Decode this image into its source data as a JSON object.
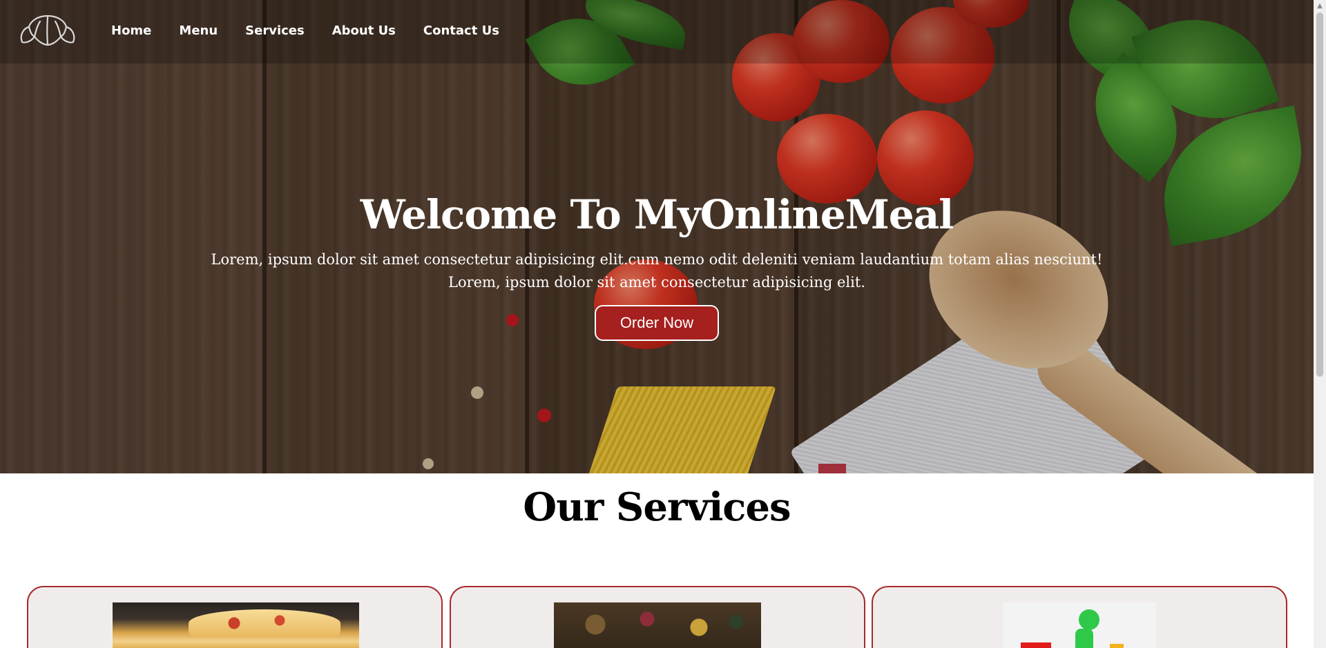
{
  "nav": {
    "logo_icon": "croissant-logo-icon",
    "links": [
      {
        "label": "Home"
      },
      {
        "label": "Menu"
      },
      {
        "label": "Services"
      },
      {
        "label": "About Us"
      },
      {
        "label": "Contact Us"
      }
    ]
  },
  "hero": {
    "title": "Welcome To MyOnlineMeal",
    "subtitle_line1": "Lorem, ipsum dolor sit amet consectetur adipisicing elit.cum nemo odit deleniti veniam laudantium totam alias nesciunt!",
    "subtitle_line2": "Lorem, ipsum dolor sit amet consectetur adipisicing elit.",
    "order_button": "Order Now",
    "accent_color": "#a5201e"
  },
  "services": {
    "heading": "Our Services",
    "card_border_color": "#a52a2a",
    "cards": [
      {
        "image": "pizza-slice-image"
      },
      {
        "image": "food-platter-image"
      },
      {
        "image": "delivery-rider-image"
      }
    ]
  }
}
